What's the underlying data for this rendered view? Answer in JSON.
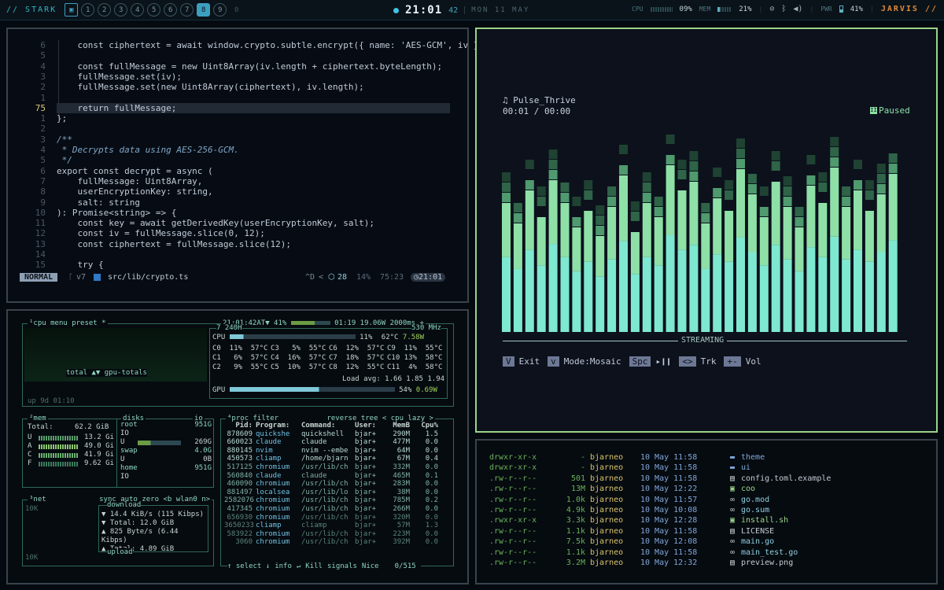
{
  "topbar": {
    "brand": "// STARK",
    "workspaces": [
      "1",
      "2",
      "3",
      "4",
      "5",
      "6",
      "7",
      "8",
      "9",
      "0"
    ],
    "active": "8",
    "time": "21:01",
    "seconds": "42",
    "date": "MON 11 MAY",
    "cpu_label": "CPU",
    "cpu": "09%",
    "mem_label": "MEM",
    "mem": "21%",
    "pwr_label": "PWR",
    "battery": "41%",
    "jarvis": "JARVIS //"
  },
  "editor": {
    "lines": [
      {
        "n": "6",
        "t": "    const ciphertext = await window.crypto.subtle.encrypt({ name: 'AES-GCM', iv }, key"
      },
      {
        "n": "5",
        "t": ""
      },
      {
        "n": "4",
        "t": "    const fullMessage = new Uint8Array(iv.length + ciphertext.byteLength);"
      },
      {
        "n": "3",
        "t": "    fullMessage.set(iv);"
      },
      {
        "n": "2",
        "t": "    fullMessage.set(new Uint8Array(ciphertext), iv.length);"
      },
      {
        "n": "1",
        "t": ""
      },
      {
        "n": "75",
        "t": "    return fullMessage;"
      },
      {
        "n": "1",
        "t": "};"
      },
      {
        "n": "2",
        "t": ""
      },
      {
        "n": "3",
        "t": "/**"
      },
      {
        "n": "4",
        "t": " * Decrypts data using AES-256-GCM."
      },
      {
        "n": "5",
        "t": " */"
      },
      {
        "n": "6",
        "t": "export const decrypt = async ("
      },
      {
        "n": "7",
        "t": "    fullMessage: Uint8Array,"
      },
      {
        "n": "8",
        "t": "    userEncryptionKey: string,"
      },
      {
        "n": "9",
        "t": "    salt: string"
      },
      {
        "n": "10",
        "t": "): Promise<string> => {"
      },
      {
        "n": "11",
        "t": "    const key = await getDerivedKey(userEncryptionKey, salt);"
      },
      {
        "n": "12",
        "t": "    const iv = fullMessage.slice(0, 12);"
      },
      {
        "n": "13",
        "t": "    const ciphertext = fullMessage.slice(12);"
      },
      {
        "n": "14",
        "t": ""
      },
      {
        "n": "15",
        "t": "    try {"
      }
    ],
    "status": {
      "mode": "NORMAL",
      "branch": "v7",
      "file": "src/lib/crypto.ts",
      "keys": "^D",
      "count": "28",
      "percent": "14%",
      "pos": "75:23",
      "clock": "21:01"
    }
  },
  "btop": {
    "cpu_title": "¹cpu",
    "menu": "menu",
    "preset": "preset *",
    "time": "21:01:42",
    "at": "AT▼ 41%",
    "bat_time": "01:19 19.06W",
    "interval": "2000ms +",
    "uptime": "up 9d 01:10",
    "total": "total ▲▼ gpu-totals",
    "cpu_model": "7 240H",
    "freq": "530 MHz",
    "cpu_row": {
      "name": "CPU",
      "pct": "11%",
      "temp": "62°C",
      "watt": "7.58W"
    },
    "cores": [
      "C0  11%  57°C",
      "C3   5%  55°C",
      "C6  12%  57°C",
      "C9  11%  55°C",
      "C1   6%  57°C",
      "C4  16%  57°C",
      "C7  18%  57°C",
      "C10 13%  58°C",
      "C2   9%  55°C",
      "C5  10%  57°C",
      "C8  12%  55°C",
      "C11  4%  58°C"
    ],
    "load": "Load avg: 1.66 1.85 1.94",
    "gpu_row": {
      "name": "GPU",
      "pct": "54%",
      "watt": "0.69W"
    },
    "mem": {
      "title": "²mem",
      "total_label": "Total:",
      "total": "62.2 GiB",
      "rows": [
        [
          "U",
          "13.2 Gi"
        ],
        [
          "A",
          "49.0 Gi"
        ],
        [
          "C",
          "41.9 Gi"
        ],
        [
          "F",
          "9.62 Gi"
        ]
      ]
    },
    "disks": {
      "title": "disks",
      "io": "io",
      "root": "root",
      "root_size": "951G",
      "io_label": "IO",
      "u1": "U",
      "u1_val": "269G",
      "swap": "swap",
      "swap_size": "4.0G",
      "u2": "U",
      "u2_val": "0B",
      "home": "home",
      "home_size": "951G",
      "io2": "IO"
    },
    "net": {
      "title": "³net",
      "sync": "sync",
      "auto": "auto",
      "zero": "zero",
      "iface": "<b wlan0 n>",
      "top": "10K",
      "bottom": "10K",
      "download": "download",
      "d1": "▼ 14.4 KiB/s  (115 Kibps)",
      "d2": "▼ Total:         12.0 GiB",
      "u1": "▲ 825 Byte/s (6.44 Kibps)",
      "u2": "▲ Total:         4.89 GiB",
      "upload": "upload"
    },
    "proc": {
      "title": "⁴proc",
      "filter": "filter",
      "reverse": "reverse",
      "tree": "tree",
      "sort": "< cpu lazy >",
      "headers": [
        "Pid:",
        "Program:",
        "Command:",
        "User:",
        "MemB",
        "Cpu%"
      ],
      "rows": [
        [
          "878609",
          "quickshe",
          "quickshell",
          "bjar+",
          "290M",
          "1.5"
        ],
        [
          "660023",
          "claude",
          "claude",
          "bjar+",
          "477M",
          "0.0"
        ],
        [
          "880145",
          "nvim",
          "nvim --embe",
          "bjar+",
          "64M",
          "0.0"
        ],
        [
          "450573",
          "cliamp",
          "/home/bjarn",
          "bjar+",
          "67M",
          "0.4"
        ],
        [
          "517125",
          "chromium",
          "/usr/lib/ch",
          "bjar+",
          "332M",
          "0.0"
        ],
        [
          "560840",
          "claude",
          "claude",
          "bjar+",
          "465M",
          "0.1"
        ],
        [
          "460090",
          "chromium",
          "/usr/lib/ch",
          "bjar+",
          "283M",
          "0.0"
        ],
        [
          "881497",
          "localsea",
          "/usr/lib/lo",
          "bjar+",
          "38M",
          "0.0"
        ],
        [
          "2582076",
          "chromium",
          "/usr/lib/ch",
          "bjar+",
          "785M",
          "0.2"
        ],
        [
          "417345",
          "chromium",
          "/usr/lib/ch",
          "bjar+",
          "266M",
          "0.0"
        ],
        [
          "656930",
          "chromium",
          "/usr/lib/ch",
          "bjar+",
          "320M",
          "0.0"
        ],
        [
          "3650233",
          "cliamp",
          "cliamp",
          "bjar+",
          "57M",
          "1.3"
        ],
        [
          "583922",
          "chromium",
          "/usr/lib/ch",
          "bjar+",
          "223M",
          "0.0"
        ],
        [
          "3060",
          "chromium",
          "/usr/lib/ch",
          "bjar+",
          "392M",
          "0.0"
        ]
      ],
      "footer": [
        "↑ select ↓",
        "info",
        "↵",
        "Kill",
        "signals",
        "Nice",
        "0/515"
      ]
    }
  },
  "player": {
    "track": "♫ Pulse_Thrive",
    "time": "00:01 / 00:00",
    "status": "Paused",
    "streaming": "STREAMING",
    "keys": [
      {
        "k": "V",
        "label": "Exit"
      },
      {
        "k": "v",
        "label": "Mode:Mosaic"
      },
      {
        "k": "Spc",
        "label": "▸❙❙"
      },
      {
        "k": "<>",
        "label": "Trk"
      },
      {
        "k": "+-",
        "label": "Vol"
      }
    ],
    "bars": [
      0.62,
      0.52,
      0.68,
      0.55,
      0.73,
      0.62,
      0.5,
      0.58,
      0.46,
      0.6,
      0.75,
      0.48,
      0.62,
      0.55,
      0.8,
      0.68,
      0.72,
      0.52,
      0.64,
      0.58,
      0.78,
      0.66,
      0.55,
      0.72,
      0.6,
      0.5,
      0.7,
      0.62,
      0.79,
      0.6,
      0.68,
      0.58,
      0.66,
      0.76
    ]
  },
  "files": {
    "rows": [
      [
        "drwxr-xr-x",
        "-",
        "bjarneo",
        "10 May 11:58",
        "theme",
        "d"
      ],
      [
        "drwxr-xr-x",
        "-",
        "bjarneo",
        "10 May 11:58",
        "ui",
        "d"
      ],
      [
        ".rw-r--r--",
        "501",
        "bjarneo",
        "10 May 11:58",
        "config.toml.example",
        "f"
      ],
      [
        ".rw-r--r--",
        "13M",
        "bjarneo",
        "10 May 12:22",
        "coo",
        "x"
      ],
      [
        ".rw-r--r--",
        "1.0k",
        "bjarneo",
        "10 May 11:57",
        "go.mod",
        "g"
      ],
      [
        ".rw-r--r--",
        "4.9k",
        "bjarneo",
        "10 May 10:08",
        "go.sum",
        "g"
      ],
      [
        ".rwxr-xr-x",
        "3.3k",
        "bjarneo",
        "10 May 12:28",
        "install.sh",
        "x"
      ],
      [
        ".rw-r--r--",
        "1.1k",
        "bjarneo",
        "10 May 11:58",
        "LICENSE",
        "f"
      ],
      [
        ".rw-r--r--",
        "7.5k",
        "bjarneo",
        "10 May 12:08",
        "main.go",
        "g"
      ],
      [
        ".rw-r--r--",
        "1.1k",
        "bjarneo",
        "10 May 11:58",
        "main_test.go",
        "g"
      ],
      [
        ".rw-r--r--",
        "3.2M",
        "bjarneo",
        "10 May 12:32",
        "preview.png",
        "f"
      ]
    ]
  }
}
